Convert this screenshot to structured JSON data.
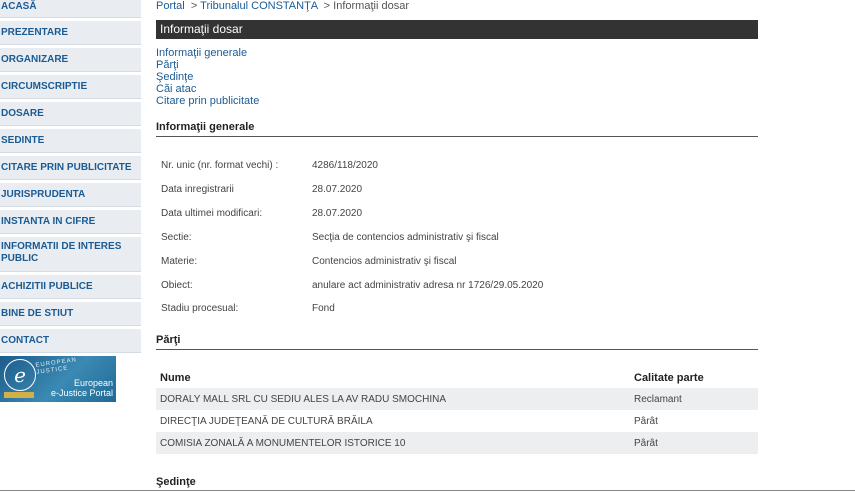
{
  "sidebar": {
    "items": [
      {
        "label": "ACASĂ"
      },
      {
        "label": "PREZENTARE"
      },
      {
        "label": "ORGANIZARE"
      },
      {
        "label": "CIRCUMSCRIPTIE"
      },
      {
        "label": "DOSARE"
      },
      {
        "label": "SEDINTE"
      },
      {
        "label": "CITARE PRIN PUBLICITATE"
      },
      {
        "label": "JURISPRUDENTA"
      },
      {
        "label": "INSTANTA IN CIFRE"
      },
      {
        "label": "INFORMATII DE INTERES PUBLIC"
      },
      {
        "label": "ACHIZITII PUBLICE"
      },
      {
        "label": "BINE DE STIUT"
      },
      {
        "label": "CONTACT"
      }
    ],
    "banner": {
      "logo_letter": "e",
      "tag_line1": "EUROPEAN",
      "tag_line2": "JUSTICE",
      "title_line1": "European",
      "title_line2": "e-Justice Portal"
    }
  },
  "breadcrumb": {
    "portal": "Portal",
    "court": "Tribunalul CONSTANŢA",
    "current": "Informaţii dosar",
    "separator": ">"
  },
  "header": {
    "title": "Informaţii dosar"
  },
  "anchors": [
    {
      "label": "Informaţii generale"
    },
    {
      "label": "Părţi"
    },
    {
      "label": "Şedinţe"
    },
    {
      "label": "Căi atac"
    },
    {
      "label": "Citare prin publicitate"
    }
  ],
  "general": {
    "title": "Informaţii generale",
    "rows": [
      {
        "label": "Nr. unic (nr. format vechi) :",
        "value": "4286/118/2020"
      },
      {
        "label": "Data inregistrarii",
        "value": "28.07.2020"
      },
      {
        "label": "Data ultimei modificari:",
        "value": "28.07.2020"
      },
      {
        "label": "Sectie:",
        "value": "Secţia de contencios administrativ şi fiscal"
      },
      {
        "label": "Materie:",
        "value": "Contencios administrativ şi fiscal"
      },
      {
        "label": "Obiect:",
        "value": "anulare act administrativ adresa nr 1726/29.05.2020"
      },
      {
        "label": "Stadiu procesual:",
        "value": "Fond"
      }
    ]
  },
  "parti": {
    "title": "Părţi",
    "col_name": "Nume",
    "col_role": "Calitate parte",
    "rows": [
      {
        "name": "DORALY MALL SRL CU SEDIU ALES LA AV RADU SMOCHINA",
        "role": "Reclamant"
      },
      {
        "name": "DIRECŢIA JUDEŢEANĂ DE CULTURĂ BRĂILA",
        "role": "Pârât"
      },
      {
        "name": "COMISIA ZONALĂ A MONUMENTELOR ISTORICE 10",
        "role": "Pârât"
      }
    ]
  },
  "sedinte": {
    "title": "Şedinţe"
  }
}
